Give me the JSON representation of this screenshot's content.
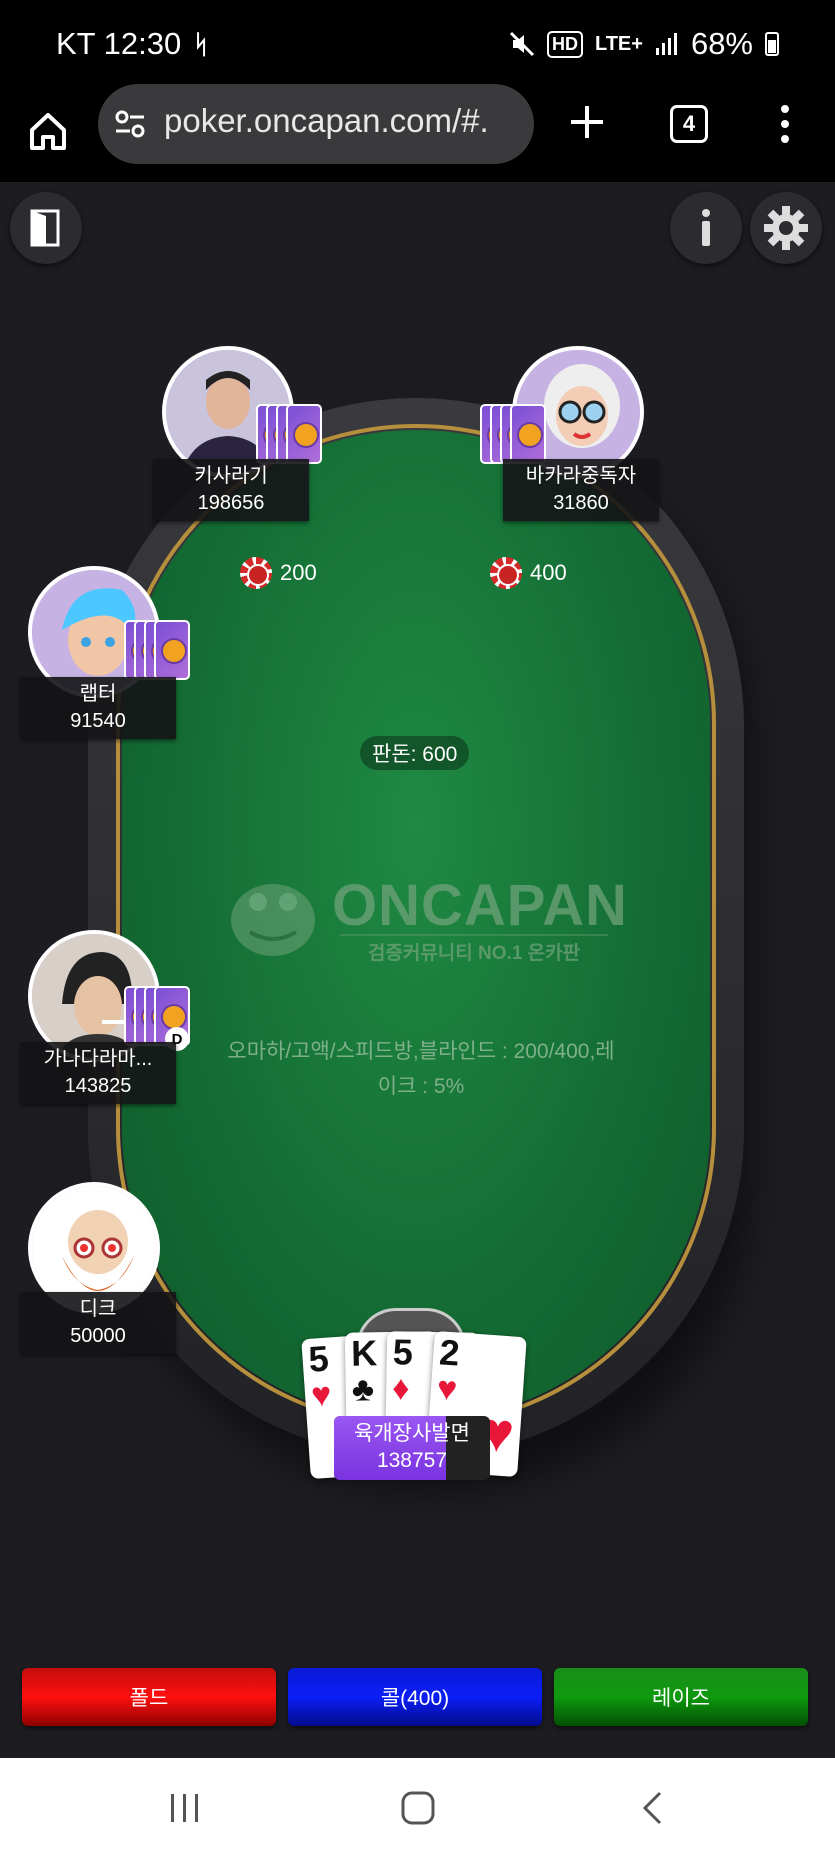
{
  "status_bar": {
    "carrier_time": "KT 12:30",
    "network_badge": "HD",
    "lte": "LTE+",
    "battery": "68%"
  },
  "browser": {
    "url": "poker.oncapan.com/#.",
    "tab_count": "4"
  },
  "table": {
    "pot_label": "판돈: 600",
    "room_info_line1": "오마하/고액/스피드방,블라인드 : 200/400,레",
    "room_info_line2": "이크 : 5%",
    "logo_text": "ONCAPAN",
    "logo_sub": "검증커뮤니티 NO.1 온카판"
  },
  "bets": [
    {
      "amount": "200"
    },
    {
      "amount": "400"
    }
  ],
  "players": [
    {
      "name": "키사라기",
      "chips": "198656"
    },
    {
      "name": "바카라중독자",
      "chips": "31860"
    },
    {
      "name": "랩터",
      "chips": "91540"
    },
    {
      "name": "가나다라마...",
      "chips": "143825",
      "dealer": "D"
    },
    {
      "name": "디크",
      "chips": "50000"
    }
  ],
  "hero": {
    "name": "육개장사발면",
    "chips": "138757",
    "timer_fraction": 0.72,
    "cards": [
      {
        "rank": "5",
        "suit": "♥"
      },
      {
        "rank": "K",
        "suit": "♣"
      },
      {
        "rank": "5",
        "suit": "♦"
      },
      {
        "rank": "2",
        "suit": "♥"
      }
    ]
  },
  "actions": {
    "fold": "폴드",
    "call": "콜(400)",
    "raise": "레이즈"
  },
  "colors": {
    "felt": "#136b33",
    "fold": "#ff0f0f",
    "call": "#0b1ff6",
    "raise": "#0e9a0e"
  }
}
